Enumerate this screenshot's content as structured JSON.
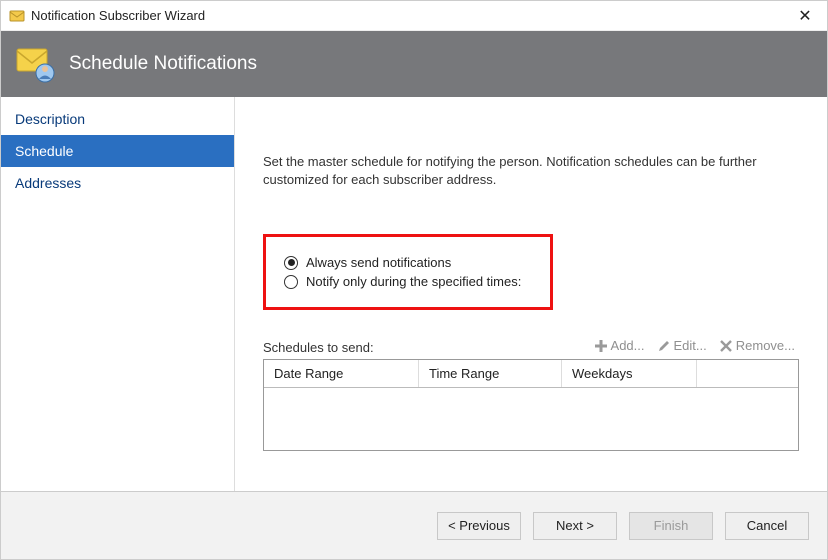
{
  "window": {
    "title": "Notification Subscriber Wizard"
  },
  "header": {
    "title": "Schedule Notifications"
  },
  "sidebar": {
    "items": [
      {
        "label": "Description",
        "selected": false
      },
      {
        "label": "Schedule",
        "selected": true
      },
      {
        "label": "Addresses",
        "selected": false
      }
    ]
  },
  "main": {
    "intro": "Set the master schedule for notifying the person. Notification schedules can be further customized for each subscriber address.",
    "radio_always": "Always send notifications",
    "radio_specified": "Notify only during the specified times:",
    "selected_radio": "always",
    "schedules_label": "Schedules to send:",
    "toolbar": {
      "add": "Add...",
      "edit": "Edit...",
      "remove": "Remove..."
    },
    "columns": {
      "date_range": "Date Range",
      "time_range": "Time Range",
      "weekdays": "Weekdays"
    }
  },
  "footer": {
    "previous": "< Previous",
    "next": "Next >",
    "finish": "Finish",
    "cancel": "Cancel"
  }
}
